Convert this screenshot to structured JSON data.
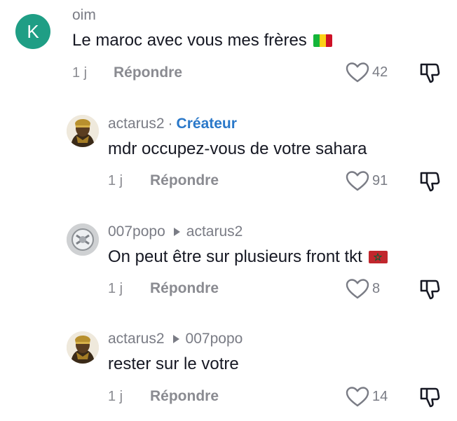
{
  "comments": [
    {
      "username": "oim",
      "avatar_letter": "K",
      "text": "Le maroc avec vous mes frères",
      "flag": "mali-flag",
      "time": "1 j",
      "reply_label": "Répondre",
      "likes": "42"
    },
    {
      "username": "actarus2",
      "badge_separator": "·",
      "badge": "Créateur",
      "text": "mdr occupez-vous de votre sahara",
      "time": "1 j",
      "reply_label": "Répondre",
      "likes": "91"
    },
    {
      "username": "007popo",
      "reply_to": "actarus2",
      "text": "On peut être sur plusieurs front tkt",
      "flag": "morocco-flag",
      "time": "1 j",
      "reply_label": "Répondre",
      "likes": "8"
    },
    {
      "username": "actarus2",
      "reply_to": "007popo",
      "text": "rester sur le votre",
      "time": "1 j",
      "reply_label": "Répondre",
      "likes": "14"
    }
  ],
  "colors": {
    "avatar_letter_bg": "#1f9e85",
    "creator_badge": "#2a78c9",
    "secondary_text": "#7a7c85"
  }
}
